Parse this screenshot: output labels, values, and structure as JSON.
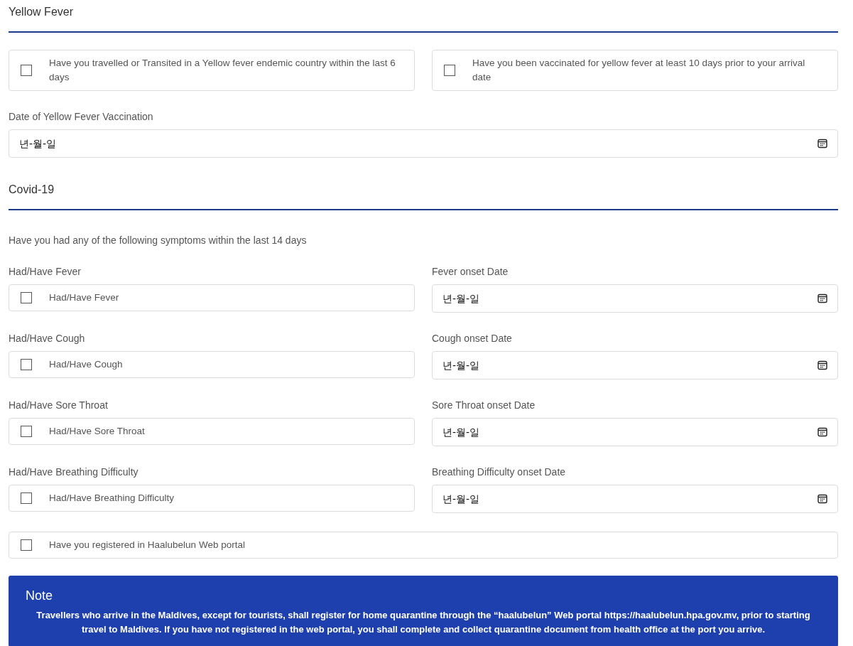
{
  "yellow_fever": {
    "heading": "Yellow Fever",
    "questions": [
      {
        "label": "Have you travelled or Transited in a Yellow fever endemic country within the last 6 days",
        "checked": false
      },
      {
        "label": "Have you been vaccinated for yellow fever at least 10 days prior to your arrival date",
        "checked": false
      }
    ],
    "vaccination_date": {
      "label": "Date of Yellow Fever Vaccination",
      "placeholder": "년-월-일"
    }
  },
  "covid": {
    "heading": "Covid-19",
    "intro": "Have you had any of the following symptoms within the last 14 days",
    "symptoms": [
      {
        "label": "Had/Have Fever",
        "checkbox_label": "Had/Have Fever",
        "checked": false,
        "date_label": "Fever onset Date",
        "date_placeholder": "년-월-일"
      },
      {
        "label": "Had/Have Cough",
        "checkbox_label": "Had/Have Cough",
        "checked": false,
        "date_label": "Cough onset Date",
        "date_placeholder": "년-월-일"
      },
      {
        "label": "Had/Have Sore Throat",
        "checkbox_label": "Had/Have Sore Throat",
        "checked": false,
        "date_label": "Sore Throat onset Date",
        "date_placeholder": "년-월-일"
      },
      {
        "label": "Had/Have Breathing Difficulty",
        "checkbox_label": "Had/Have Breathing Difficulty",
        "checked": false,
        "date_label": "Breathing Difficulty onset Date",
        "date_placeholder": "년-월-일"
      }
    ],
    "registered": {
      "label": "Have you registered in Haalubelun Web portal",
      "checked": false
    }
  },
  "note": {
    "title": "Note",
    "text": "Travellers who arrive in the Maldives, except for tourists, shall register for home quarantine through the “haalubelun” Web portal https://haalubelun.hpa.gov.mv, prior to starting travel to Maldives. If you have not registered in the web portal, you shall complete and collect quarantine document from health office at the port you arrive."
  }
}
